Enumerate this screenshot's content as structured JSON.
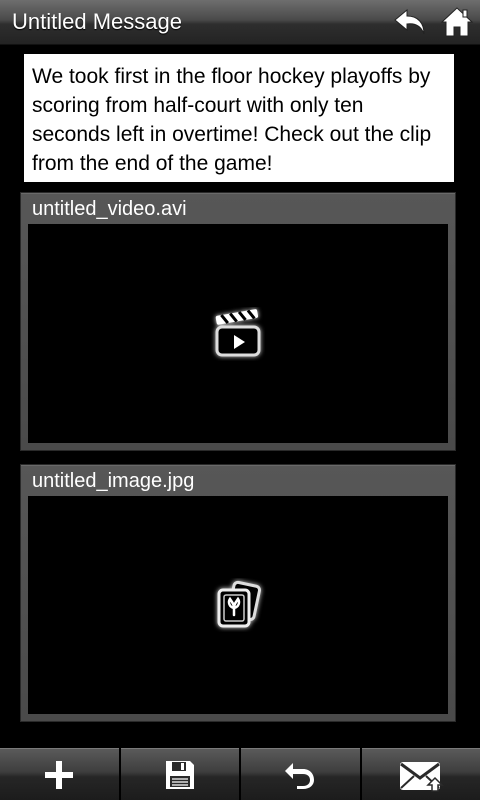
{
  "header": {
    "title": "Untitled Message",
    "reply_icon": "reply-arrow-icon",
    "home_icon": "home-icon"
  },
  "message": {
    "text": "We took first in the floor hockey playoffs by scoring from half-court with only ten seconds left in overtime!  Check out the clip from the end of the game!"
  },
  "attachments": [
    {
      "name": "untitled_video.avi",
      "icon": "video-clapperboard-icon"
    },
    {
      "name": "untitled_image.jpg",
      "icon": "photo-stack-icon"
    }
  ],
  "toolbar": {
    "buttons": [
      {
        "icon": "add-icon"
      },
      {
        "icon": "save-icon"
      },
      {
        "icon": "undo-icon"
      },
      {
        "icon": "send-mail-icon"
      }
    ]
  },
  "colors": {
    "background": "#000000",
    "message_bg": "#ffffff",
    "panel_bg": "#505050"
  }
}
